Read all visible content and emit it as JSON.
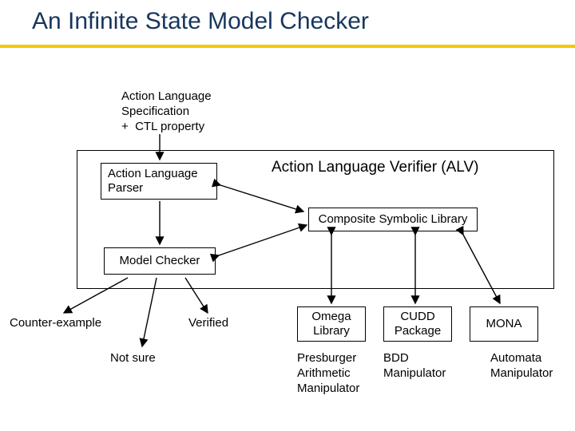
{
  "title": "An Infinite State Model Checker",
  "input_spec": "Action Language\nSpecification\n+  CTL property",
  "alv_label": "Action Language Verifier (ALV)",
  "parser": "Action Language\nParser",
  "csl": "Composite Symbolic Library",
  "model_checker": "Model Checker",
  "outputs": {
    "counter_example": "Counter-example",
    "verified": "Verified",
    "not_sure": "Not sure"
  },
  "libs": {
    "omega": {
      "name": "Omega\nLibrary",
      "desc": "Presburger\nArithmetic\nManipulator"
    },
    "cudd": {
      "name": "CUDD\nPackage",
      "desc": "BDD\nManipulator"
    },
    "mona": {
      "name": "MONA",
      "desc": "Automata\nManipulator"
    }
  }
}
